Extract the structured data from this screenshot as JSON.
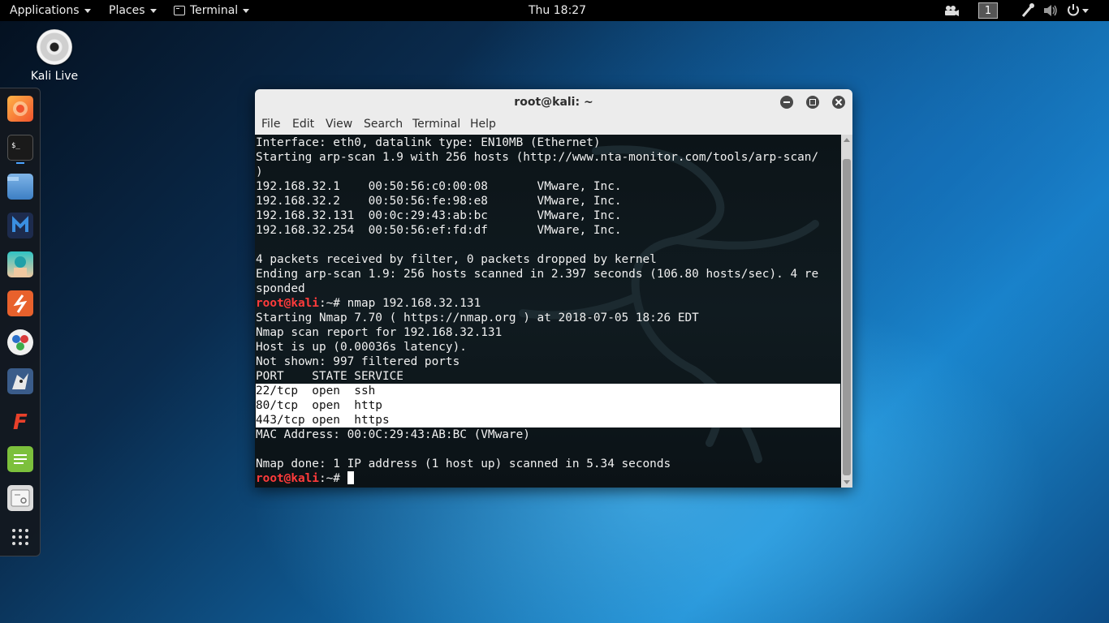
{
  "topbar": {
    "applications": "Applications",
    "places": "Places",
    "terminal": "Terminal",
    "clock": "Thu 18:27",
    "workspace": "1"
  },
  "desktop": {
    "icon_label": "Kali Live"
  },
  "dock": {
    "items": [
      "firefox-icon",
      "terminal-icon",
      "files-icon",
      "metasploit-icon",
      "armitage-icon",
      "burpsuite-icon",
      "maltego-icon",
      "beef-icon",
      "faraday-icon",
      "leafpad-icon",
      "cherrytree-icon",
      "show-apps-icon"
    ]
  },
  "window": {
    "title": "root@kali: ~",
    "menu": [
      "File",
      "Edit",
      "View",
      "Search",
      "Terminal",
      "Help"
    ]
  },
  "terminal": {
    "prompt_user": "root@kali",
    "prompt_suffix": ":~# ",
    "lines": [
      "Interface: eth0, datalink type: EN10MB (Ethernet)",
      "Starting arp-scan 1.9 with 256 hosts (http://www.nta-monitor.com/tools/arp-scan/",
      ")",
      "192.168.32.1    00:50:56:c0:00:08       VMware, Inc.",
      "192.168.32.2    00:50:56:fe:98:e8       VMware, Inc.",
      "192.168.32.131  00:0c:29:43:ab:bc       VMware, Inc.",
      "192.168.32.254  00:50:56:ef:fd:df       VMware, Inc.",
      "",
      "4 packets received by filter, 0 packets dropped by kernel",
      "Ending arp-scan 1.9: 256 hosts scanned in 2.397 seconds (106.80 hosts/sec). 4 re",
      "sponded",
      "nmap 192.168.32.131",
      "Starting Nmap 7.70 ( https://nmap.org ) at 2018-07-05 18:26 EDT",
      "Nmap scan report for 192.168.32.131",
      "Host is up (0.00036s latency).",
      "Not shown: 997 filtered ports",
      "PORT    STATE SERVICE",
      "22/tcp  open  ssh",
      "80/tcp  open  http",
      "443/tcp open  https",
      "MAC Address: 00:0C:29:43:AB:BC (VMware)",
      "",
      "Nmap done: 1 IP address (1 host up) scanned in 5.34 seconds",
      ""
    ],
    "prompt_line_indices": [
      11,
      23
    ],
    "highlighted_line_indices": [
      17,
      18,
      19
    ]
  },
  "colors": {
    "prompt": "#ff3b3b",
    "selection_bg": "#ffffff",
    "terminal_bg": "#0e171b"
  }
}
